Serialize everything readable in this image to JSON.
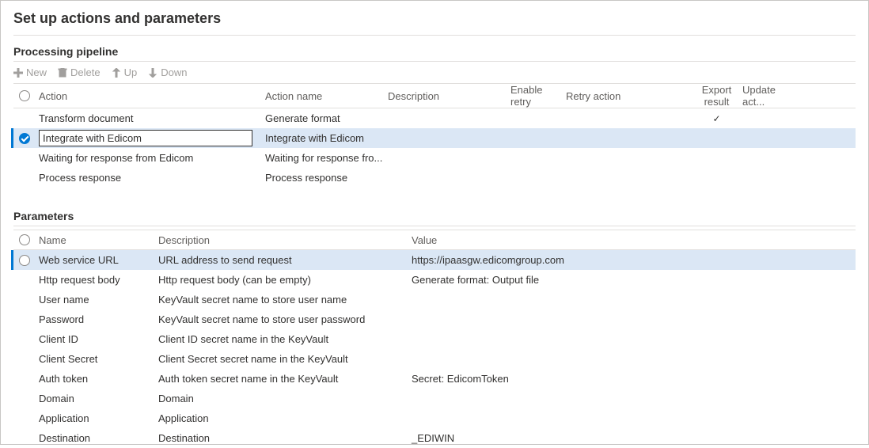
{
  "page": {
    "title": "Set up actions and parameters"
  },
  "pipeline": {
    "title": "Processing pipeline",
    "toolbar": {
      "new": "New",
      "delete": "Delete",
      "up": "Up",
      "down": "Down"
    },
    "headers": {
      "action": "Action",
      "action_name": "Action name",
      "description": "Description",
      "enable_retry": "Enable retry",
      "retry_action": "Retry action",
      "export_result": "Export result",
      "update_action": "Update act..."
    },
    "rows": [
      {
        "selected": false,
        "action": "Transform document",
        "action_name": "Generate format",
        "description": "",
        "enable_retry": "",
        "retry_action": "",
        "export_result": true,
        "update_action": ""
      },
      {
        "selected": true,
        "action": "Integrate with Edicom",
        "action_name": "Integrate with Edicom",
        "description": "",
        "enable_retry": "",
        "retry_action": "",
        "export_result": false,
        "update_action": ""
      },
      {
        "selected": false,
        "action": "Waiting for response from Edicom",
        "action_name": "Waiting for response fro...",
        "description": "",
        "enable_retry": "",
        "retry_action": "",
        "export_result": false,
        "update_action": ""
      },
      {
        "selected": false,
        "action": "Process response",
        "action_name": "Process response",
        "description": "",
        "enable_retry": "",
        "retry_action": "",
        "export_result": false,
        "update_action": ""
      }
    ]
  },
  "parameters": {
    "title": "Parameters",
    "headers": {
      "name": "Name",
      "description": "Description",
      "value": "Value"
    },
    "rows": [
      {
        "selected": true,
        "name": "Web service URL",
        "description": "URL address to send request",
        "value": "https://ipaasgw.edicomgroup.com"
      },
      {
        "selected": false,
        "name": "Http request body",
        "description": "Http request body (can be empty)",
        "value": "Generate format: Output file"
      },
      {
        "selected": false,
        "name": "User name",
        "description": "KeyVault secret name to store user name",
        "value": ""
      },
      {
        "selected": false,
        "name": "Password",
        "description": "KeyVault secret name to store user password",
        "value": ""
      },
      {
        "selected": false,
        "name": "Client ID",
        "description": "Client ID secret name in the KeyVault",
        "value": ""
      },
      {
        "selected": false,
        "name": "Client Secret",
        "description": "Client Secret secret name in the KeyVault",
        "value": ""
      },
      {
        "selected": false,
        "name": "Auth token",
        "description": "Auth token secret name in the KeyVault",
        "value": "Secret:  EdicomToken"
      },
      {
        "selected": false,
        "name": "Domain",
        "description": "Domain",
        "value": ""
      },
      {
        "selected": false,
        "name": "Application",
        "description": "Application",
        "value": ""
      },
      {
        "selected": false,
        "name": "Destination",
        "description": "Destination",
        "value": "_EDIWIN"
      }
    ]
  }
}
